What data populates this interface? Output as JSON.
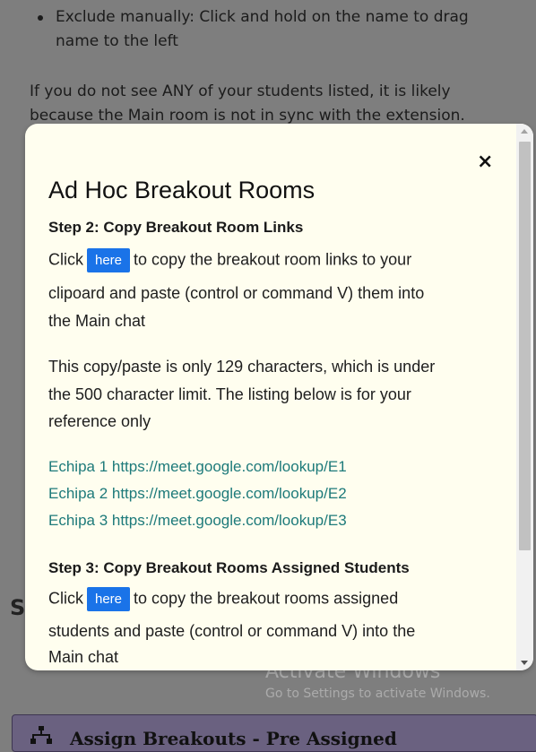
{
  "background": {
    "bullet": "Exclude manually: Click and hold on the name to drag name to the left",
    "paragraph": "If you do not see ANY of your students listed, it is likely because the Main room is not in sync with the extension.",
    "section_letter": "S",
    "watermark_title": "Activate Windows",
    "watermark_sub": "Go to Settings to activate Windows.",
    "bottom_button_label": "Assign Breakouts - Pre Assigned"
  },
  "modal": {
    "close_label": "×",
    "title": "Ad Hoc Breakout Rooms",
    "step2": {
      "title": "Step 2: Copy Breakout Room Links",
      "click_prefix": "Click",
      "here_label": "here",
      "line1_suffix": "to copy the breakout room links to your",
      "line2": "clipoard and paste (control or command V) them into",
      "line3": "the Main chat",
      "info_line1": "This copy/paste is only 129 characters, which is under",
      "info_line2": "the 500 character limit. The listing below is for your",
      "info_line3": "reference only",
      "links": [
        "Echipa 1 https://meet.google.com/lookup/E1",
        "Echipa 2 https://meet.google.com/lookup/E2",
        "Echipa 3 https://meet.google.com/lookup/E3"
      ]
    },
    "step3": {
      "title": "Step 3: Copy Breakout Rooms Assigned Students",
      "click_prefix": "Click",
      "here_label": "here",
      "line1_suffix": "to copy the breakout rooms assigned",
      "line2": "students and paste (control or command V) into the",
      "line3": "Main chat"
    }
  },
  "colors": {
    "accent_button": "#1a73e8",
    "link": "#1d7a7a",
    "modal_background": "#fffeef"
  }
}
